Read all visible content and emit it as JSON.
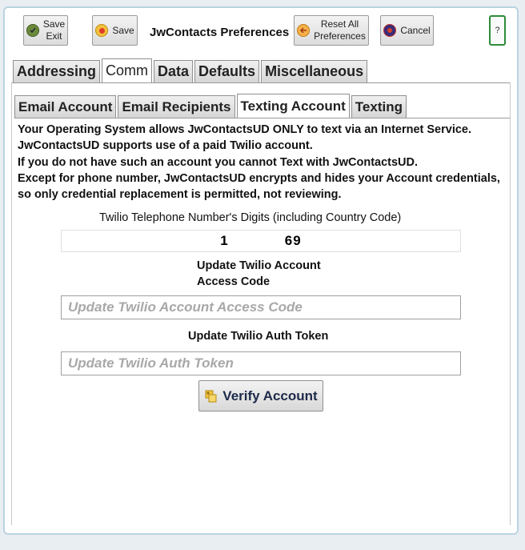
{
  "toolbar": {
    "save_exit": [
      "Save",
      "Exit"
    ],
    "save": "Save",
    "title": "JwContacts Preferences",
    "reset": [
      "Reset All",
      "Preferences"
    ],
    "cancel": "Cancel",
    "help": "?"
  },
  "tabs_main": [
    "Addressing",
    "Comm",
    "Data",
    "Defaults",
    "Miscellaneous"
  ],
  "tabs_main_active": "Comm",
  "tabs_sub": [
    "Email Account",
    "Email Recipients",
    "Texting Account",
    "Texting"
  ],
  "tabs_sub_active": "Texting Account",
  "info_lines": [
    "Your Operating System allows JwContactsUD ONLY to text via an Internet Service.",
    "JwContactsUD supports use of a paid Twilio account.",
    "If you do not have such an account you cannot Text with JwContactsUD.",
    "Except for phone number, JwContactsUD encrypts and hides your Account credentials,",
    "so  only credential replacement is permitted, not reviewing."
  ],
  "phone_label": "Twilio Telephone Number's Digits (including Country Code)",
  "phone_visible_start": "1",
  "phone_visible_end": "69",
  "access_code_label": [
    "Update Twilio Account",
    "Access Code"
  ],
  "access_code_placeholder": "Update Twilio Account Access Code",
  "auth_token_label": "Update Twilio Auth Token",
  "auth_token_placeholder": "Update Twilio Auth Token",
  "verify_label": "Verify Account",
  "colors": {
    "save_exit_icon": "#6b8a3c",
    "save_icon": "#e03b2a",
    "reset_icon": "#f2a23a",
    "cancel_icon": "#3a2a7a",
    "help_border": "#2e8b3a",
    "window_border": "#b9d3e0"
  },
  "icons": {
    "save_exit": "check-circle-icon",
    "save": "save-circle-icon",
    "reset": "arrow-left-circle-icon",
    "cancel": "cancel-circle-icon",
    "verify": "key-icon"
  }
}
